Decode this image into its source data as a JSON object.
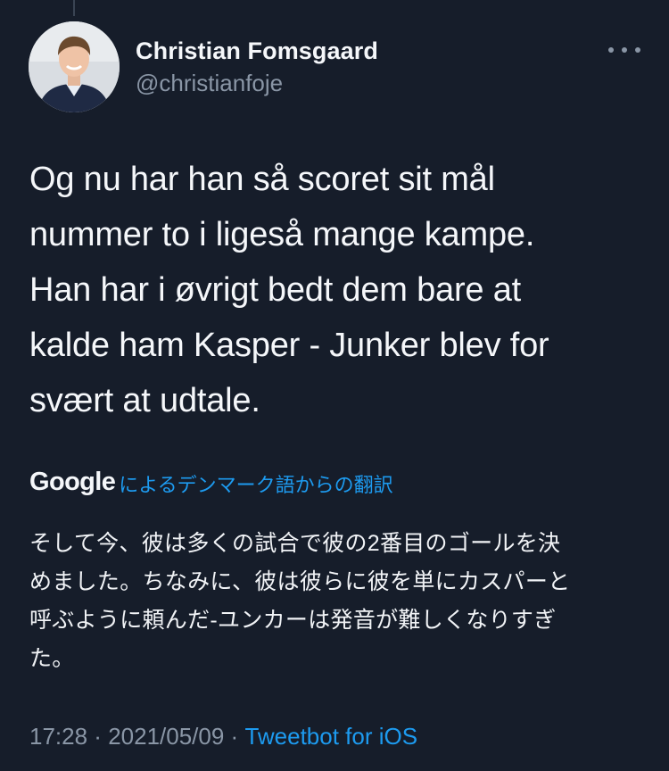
{
  "author": {
    "name": "Christian Fomsgaard",
    "handle": "@christianfoje"
  },
  "more_icon": "more-horizontal-icon",
  "tweet": {
    "lines": [
      "Og nu har han så scoret sit mål",
      "nummer to i ligeså mange kampe.",
      "Han har i øvrigt bedt dem bare at",
      "kalde ham Kasper - Junker blev for",
      "svært at udtale."
    ]
  },
  "translation": {
    "provider": "Google",
    "label": "によるデンマーク語からの翻訳",
    "lines": [
      "そして今、彼は多くの試合で彼の2番目のゴールを決",
      "めました。ちなみに、彼は彼らに彼を単にカスパーと",
      "呼ぶように頼んだ-ユンカーは発音が難しくなりすぎ",
      "た。"
    ]
  },
  "meta": {
    "time": "17:28",
    "separator": " · ",
    "date": "2021/05/09",
    "separator2": " · ",
    "client": "Tweetbot for iOS"
  },
  "colors": {
    "background": "#161d2a",
    "link": "#1d9bf0",
    "secondary_text": "#8a96a6"
  }
}
